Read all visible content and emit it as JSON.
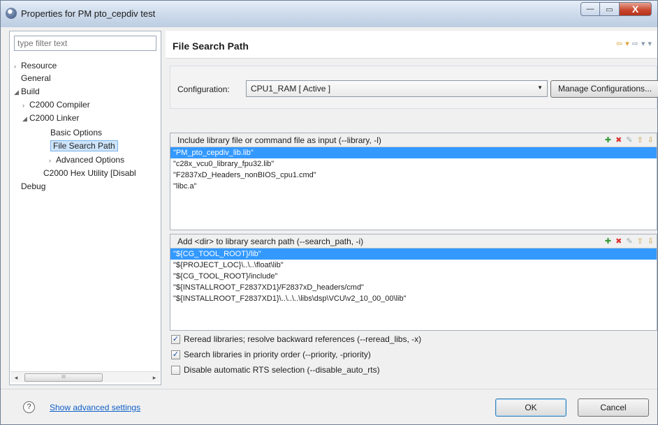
{
  "window": {
    "title": "Properties for PM pto_cepdiv test",
    "minimize_label": "—",
    "maximize_label": "▭",
    "close_label": "X"
  },
  "sidebar": {
    "filter_placeholder": "type filter text",
    "items": [
      {
        "label": "Resource",
        "twisty": "›"
      },
      {
        "label": "General",
        "twisty": ""
      },
      {
        "label": "Build",
        "twisty": "◢"
      },
      {
        "label": "C2000 Compiler",
        "twisty": "›"
      },
      {
        "label": "C2000 Linker",
        "twisty": "◢"
      },
      {
        "label": "Basic Options",
        "twisty": ""
      },
      {
        "label": "File Search Path",
        "twisty": ""
      },
      {
        "label": "Advanced Options",
        "twisty": "›"
      },
      {
        "label": "C2000 Hex Utility  [Disabl",
        "twisty": ""
      },
      {
        "label": "Debug",
        "twisty": ""
      }
    ],
    "scroll_left": "◂",
    "scroll_right": "▸",
    "scroll_grip": "III"
  },
  "main": {
    "title": "File Search Path",
    "nav": [
      "⇦",
      "▾",
      "⇨",
      "▾",
      "▾"
    ],
    "configuration_label": "Configuration:",
    "configuration_value": "CPU1_RAM  [ Active ]",
    "manage_label": "Manage Configurations...",
    "library_panel": {
      "title": "Include library file or command file as input (--library, -l)",
      "items": [
        "\"PM_pto_cepdiv_lib.lib\"",
        "\"c28x_vcu0_library_fpu32.lib\"",
        "\"F2837xD_Headers_nonBIOS_cpu1.cmd\"",
        "\"libc.a\""
      ]
    },
    "search_panel": {
      "title": "Add <dir> to library search path (--search_path, -i)",
      "items": [
        "\"${CG_TOOL_ROOT}/lib\"",
        "\"${PROJECT_LOC}\\..\\..\\float\\lib\"",
        "\"${CG_TOOL_ROOT}/include\"",
        "\"${INSTALLROOT_F2837XD1}/F2837xD_headers/cmd\"",
        "\"${INSTALLROOT_F2837XD1}\\..\\..\\..\\libs\\dsp\\VCU\\v2_10_00_00\\lib\""
      ]
    },
    "tool_icons": [
      "✚",
      "✖",
      "✎",
      "⇧",
      "⇩"
    ],
    "checkboxes": [
      {
        "label": "Reread libraries; resolve backward references (--reread_libs, -x)",
        "checked": true,
        "mark": "✓"
      },
      {
        "label": "Search libraries in priority order (--priority, -priority)",
        "checked": true,
        "mark": "✓"
      },
      {
        "label": "Disable automatic RTS selection (--disable_auto_rts)",
        "checked": false,
        "mark": ""
      }
    ]
  },
  "footer": {
    "help_label": "?",
    "advanced_link": "Show advanced settings",
    "ok_label": "OK",
    "cancel_label": "Cancel"
  }
}
